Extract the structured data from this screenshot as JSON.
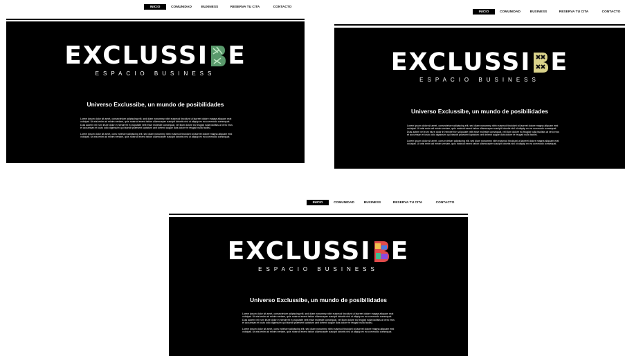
{
  "nav": {
    "items": [
      "INICIO",
      "COMUNIDAD",
      "BUXINESS",
      "RESERVA TU CITA",
      "CONTACTO"
    ],
    "active": "INICIO"
  },
  "brand": {
    "name_prefix": "EXCLUSSI",
    "b_letter": "B",
    "name_suffix": "E",
    "subtitle": "ESPACIO BUSINESS"
  },
  "content": {
    "headline": "Universo Exclussibe, un mundo de posibilidades",
    "paragraph_1": "Lorem ipsum dolor sit amet, consectetuer adipiscing elit, sed diam nonummy nibh euismod tincidunt ut laoreet dolore magna aliquam erat volutpat. Ut wisi enim ad minim veniam, quis nostrud exerci tation ullamcorper suscipit lobortis nisl ut aliquip ex ea commodo consequat. Duis autem vel eum iriure dolor in hendrerit in vulputate velit esse molestie consequat, vel illum dolore eu feugiat nulla facilisis at vero eros et accumsan et iusto odio dignissim qui blandit praesent luptatum zzril delenit augue duis dolore te feugait nulla facilisi.",
    "paragraph_2": "Lorem ipsum dolor sit amet, cons ectetuer adipiscing elit, sed diam nonummy nibh euismod tincidunt ut laoreet dolore magna aliquam erat volutpat. Ut wisi enim ad minim veniam, quis nostrud exerci tation ullamcorper suscipit lobortis nisl ut aliquip ex ea commodo consequat."
  },
  "variants": [
    {
      "name": "green-pattern-b",
      "b_color_a": "#5a9a6c",
      "b_color_b": "#9ed6a8"
    },
    {
      "name": "cream-x-b",
      "b_color_a": "#d9d28a",
      "b_color_b": "#222222"
    },
    {
      "name": "multicolor-b",
      "b_color_a": "#e24b4b",
      "b_color_b": "#4b7be2"
    }
  ]
}
